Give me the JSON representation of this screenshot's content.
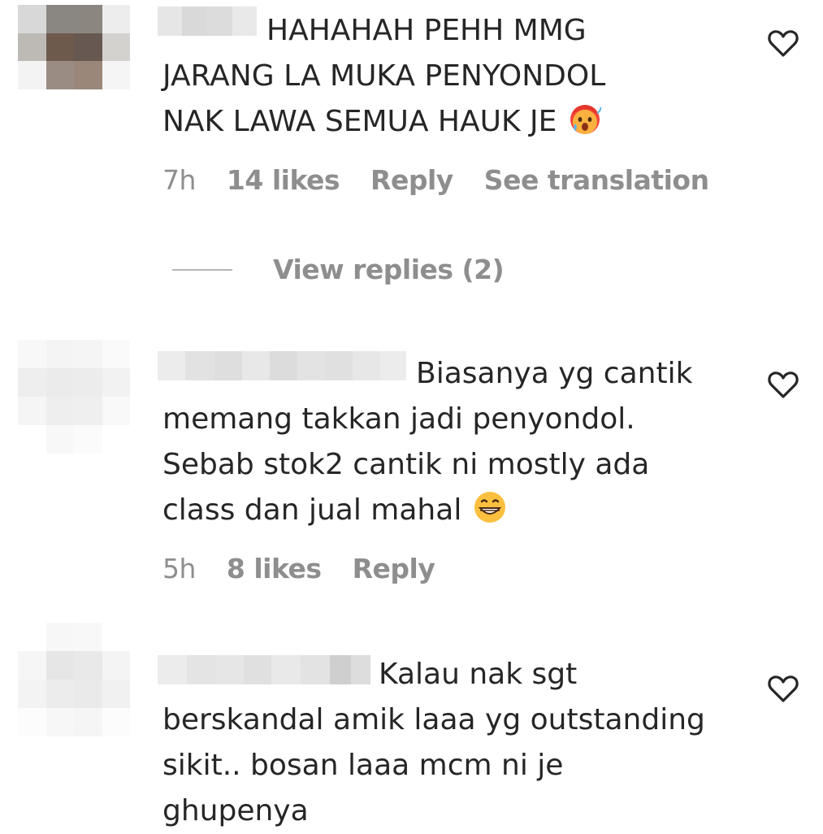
{
  "comments": [
    {
      "text_lines": [
        "HAHAHAH PEHH MMG",
        "JARANG LA MUKA PENYONDOL",
        "NAK LAWA SEMUA HAUK JE"
      ],
      "emoji": "hot-face-emoji",
      "time": "7h",
      "likes": "14 likes",
      "reply": "Reply",
      "translate": "See translation",
      "view_replies": "View replies (2)"
    },
    {
      "text_lines": [
        "Biasanya yg cantik",
        "memang takkan jadi penyondol.",
        "Sebab stok2 cantik ni mostly ada",
        "class dan jual mahal"
      ],
      "emoji": "grinning-face-emoji",
      "time": "5h",
      "likes": "8 likes",
      "reply": "Reply"
    },
    {
      "text_lines": [
        "Kalau nak sgt",
        "berskandal amik laaa yg outstanding",
        "sikit.. bosan laaa mcm ni je",
        "ghupenya"
      ]
    }
  ],
  "colors": {
    "text": "#262626",
    "meta": "#8e8e8e",
    "line": "#b5b5b5"
  }
}
